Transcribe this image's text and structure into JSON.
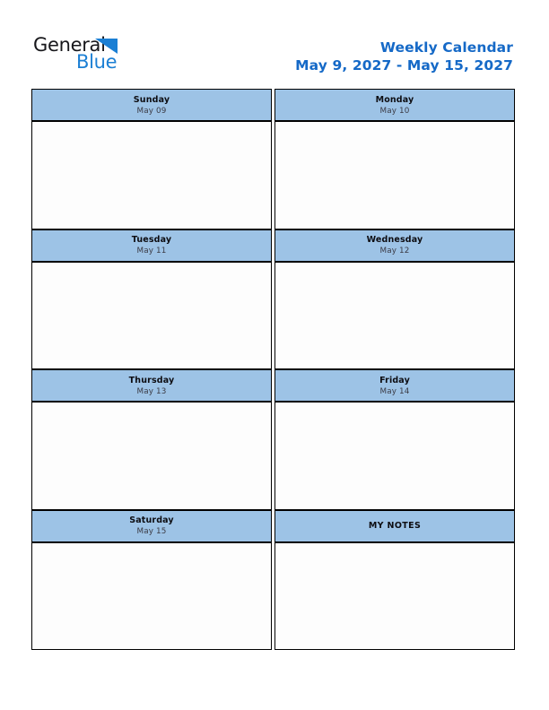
{
  "brand": {
    "word_one": "General",
    "word_two": "Blue",
    "triangle_icon": "triangle-icon",
    "brand_blue": "#1b7fd4",
    "brand_dark": "#17171b"
  },
  "header": {
    "title": "Weekly Calendar",
    "date_range": "May 9, 2027 - May 15, 2027",
    "title_color": "#1569c7"
  },
  "calendar": {
    "header_bg": "#9dc3e6",
    "border_color": "#000000",
    "cell_bg": "#fdfdfd",
    "rows": [
      {
        "cells": [
          {
            "day": "Sunday",
            "date": "May 09",
            "note_cell": false
          },
          {
            "day": "Monday",
            "date": "May 10",
            "note_cell": false
          }
        ]
      },
      {
        "cells": [
          {
            "day": "Tuesday",
            "date": "May 11",
            "note_cell": false
          },
          {
            "day": "Wednesday",
            "date": "May 12",
            "note_cell": false
          }
        ]
      },
      {
        "cells": [
          {
            "day": "Thursday",
            "date": "May 13",
            "note_cell": false
          },
          {
            "day": "Friday",
            "date": "May 14",
            "note_cell": false
          }
        ]
      },
      {
        "cells": [
          {
            "day": "Saturday",
            "date": "May 15",
            "note_cell": false
          },
          {
            "day": "MY NOTES",
            "date": "",
            "note_cell": true
          }
        ]
      }
    ]
  }
}
